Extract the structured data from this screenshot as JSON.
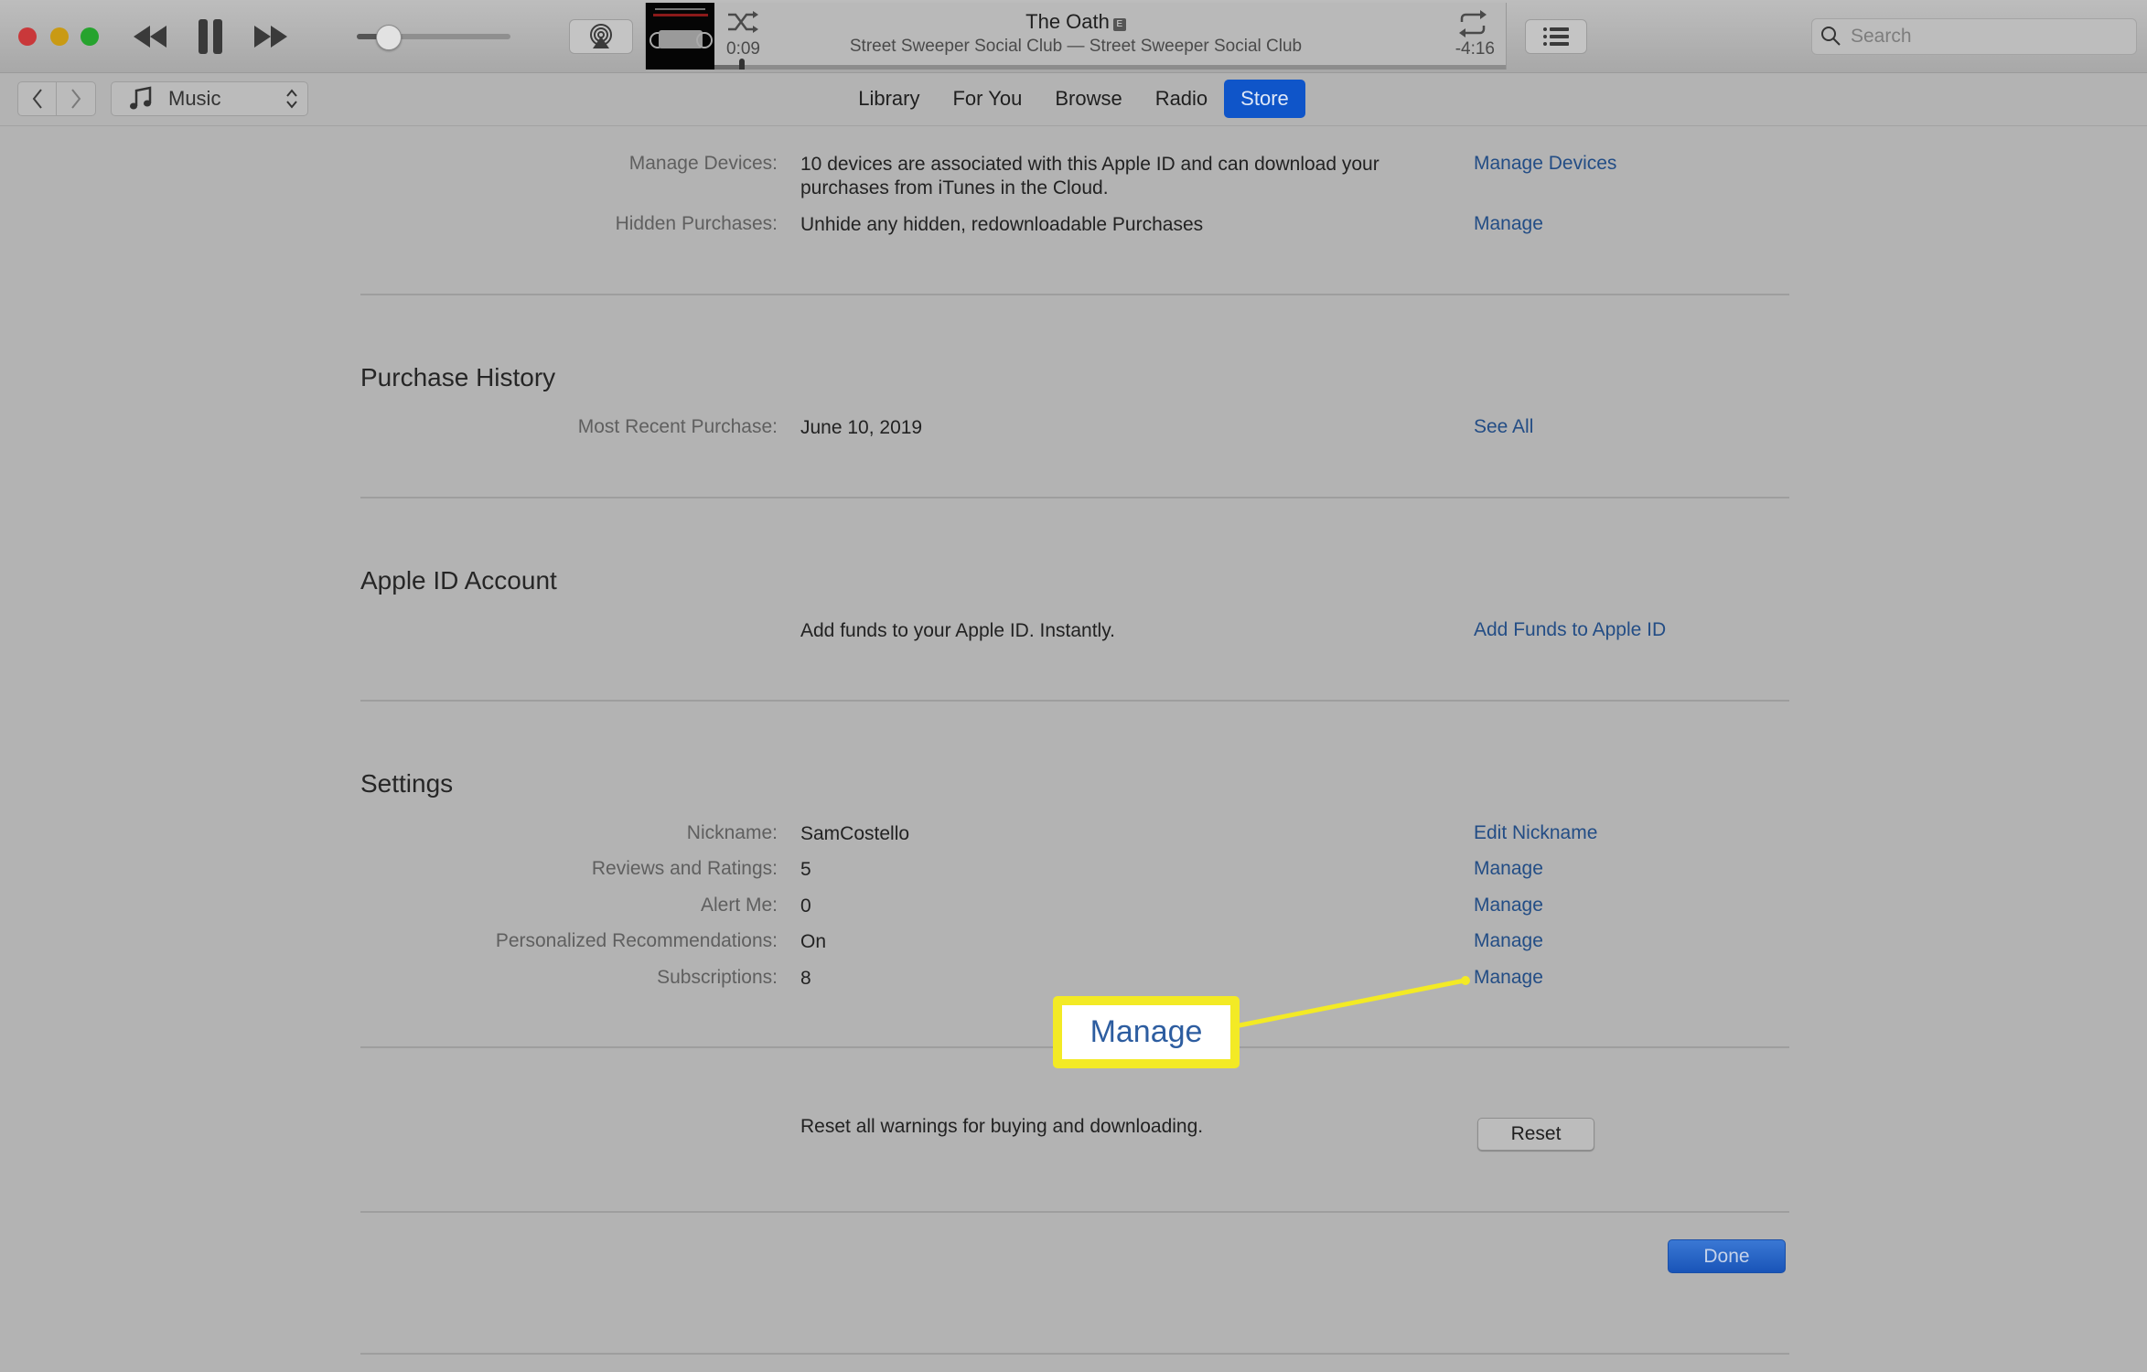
{
  "player": {
    "elapsed": "0:09",
    "remaining": "-4:16",
    "song_title": "The Oath",
    "explicit_badge": "E",
    "song_subtitle": "Street Sweeper Social Club — Street Sweeper Social Club",
    "volume_fraction": 0.2,
    "progress_fraction": 0.035
  },
  "search": {
    "placeholder": "Search",
    "value": ""
  },
  "nav": {
    "media_select": "Music",
    "tabs": [
      {
        "label": "Library",
        "active": false
      },
      {
        "label": "For You",
        "active": false
      },
      {
        "label": "Browse",
        "active": false
      },
      {
        "label": "Radio",
        "active": false
      },
      {
        "label": "Store",
        "active": true
      }
    ]
  },
  "account": {
    "top_rows": [
      {
        "label": "Manage Devices:",
        "value": "10 devices are associated with this Apple ID and can download your purchases from iTunes in the Cloud.",
        "link": "Manage Devices"
      },
      {
        "label": "Hidden Purchases:",
        "value": "Unhide any hidden, redownloadable Purchases",
        "link": "Manage"
      }
    ],
    "purchase_history": {
      "title": "Purchase History",
      "label": "Most Recent Purchase:",
      "value": "June 10, 2019",
      "link": "See All"
    },
    "apple_id_account": {
      "title": "Apple ID Account",
      "value": "Add funds to your Apple ID. Instantly.",
      "link": "Add Funds to Apple ID"
    },
    "settings": {
      "title": "Settings",
      "rows": [
        {
          "label": "Nickname:",
          "value": "SamCostello",
          "link": "Edit Nickname"
        },
        {
          "label": "Reviews and Ratings:",
          "value": "5",
          "link": "Manage"
        },
        {
          "label": "Alert Me:",
          "value": "0",
          "link": "Manage"
        },
        {
          "label": "Personalized Recommendations:",
          "value": "On",
          "link": "Manage"
        },
        {
          "label": "Subscriptions:",
          "value": "8",
          "link": "Manage"
        }
      ]
    },
    "reset": {
      "text": "Reset all warnings for buying and downloading.",
      "button": "Reset"
    },
    "done_button": "Done"
  },
  "annotation": {
    "callout_text": "Manage",
    "color": "#f3ea25"
  },
  "colors": {
    "link": "#234d85",
    "accent": "#0f55c9",
    "background": "#b3b3b3"
  }
}
